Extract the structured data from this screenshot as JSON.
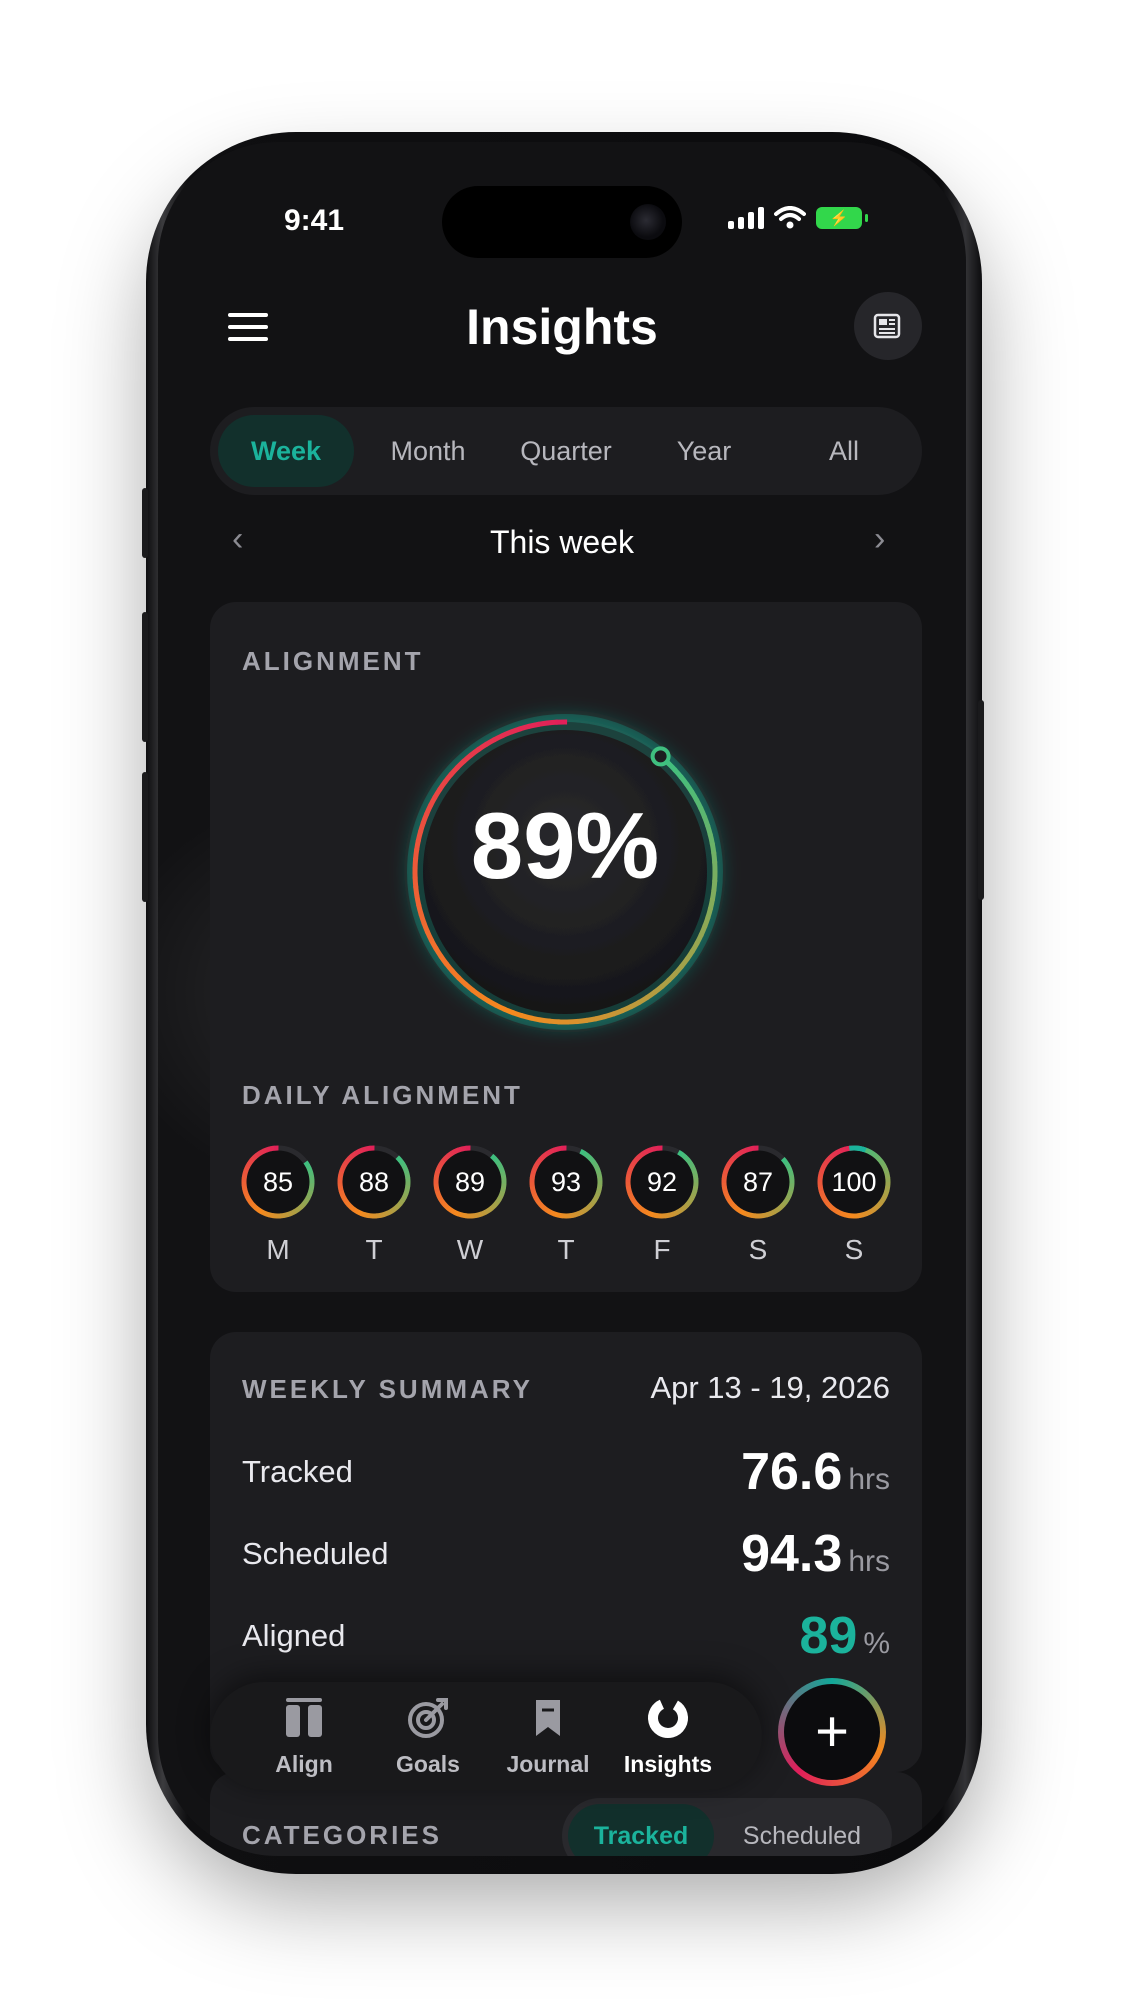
{
  "status_bar": {
    "time": "9:41",
    "battery_icon": "battery-charging-icon",
    "signal_icon": "cellular-signal-icon",
    "wifi_icon": "wifi-icon"
  },
  "header": {
    "title": "Insights",
    "menu_icon": "hamburger-menu-icon",
    "action_icon": "newspaper-icon"
  },
  "period_tabs": {
    "items": [
      "Week",
      "Month",
      "Quarter",
      "Year",
      "All"
    ],
    "selected": "Week"
  },
  "period_nav": {
    "label": "This week",
    "prev_icon": "chevron-left-icon",
    "next_icon": "chevron-right-icon"
  },
  "alignment": {
    "title": "ALIGNMENT",
    "value_text": "89%",
    "value": 89,
    "daily_title": "DAILY ALIGNMENT",
    "days": [
      {
        "day": "M",
        "value": "85"
      },
      {
        "day": "T",
        "value": "88"
      },
      {
        "day": "W",
        "value": "89"
      },
      {
        "day": "T",
        "value": "93"
      },
      {
        "day": "F",
        "value": "92"
      },
      {
        "day": "S",
        "value": "87"
      },
      {
        "day": "S",
        "value": "100"
      }
    ]
  },
  "weekly_summary": {
    "title": "WEEKLY SUMMARY",
    "date_range": "Apr 13 - 19, 2026",
    "rows": [
      {
        "label": "Tracked",
        "value": "76.6",
        "unit": "hrs"
      },
      {
        "label": "Scheduled",
        "value": "94.3",
        "unit": "hrs"
      },
      {
        "label": "Aligned",
        "value": "89",
        "unit": "%"
      }
    ]
  },
  "categories": {
    "title": "CATEGORIES",
    "toggle": [
      "Tracked",
      "Scheduled"
    ],
    "selected": "Tracked"
  },
  "tab_bar": {
    "items": [
      {
        "label": "Align",
        "icon": "pause-bars-icon"
      },
      {
        "label": "Goals",
        "icon": "target-arrow-icon"
      },
      {
        "label": "Journal",
        "icon": "bookmark-icon"
      },
      {
        "label": "Insights",
        "icon": "donut-chart-icon"
      }
    ],
    "selected": "Insights",
    "fab_icon": "plus-icon"
  },
  "colors": {
    "accent_teal": "#1bb39c",
    "ring_green": "#3fbf7f",
    "ring_orange": "#f5891e",
    "ring_pink": "#e01e5a",
    "background": "#121214",
    "card": "#1d1d20"
  }
}
